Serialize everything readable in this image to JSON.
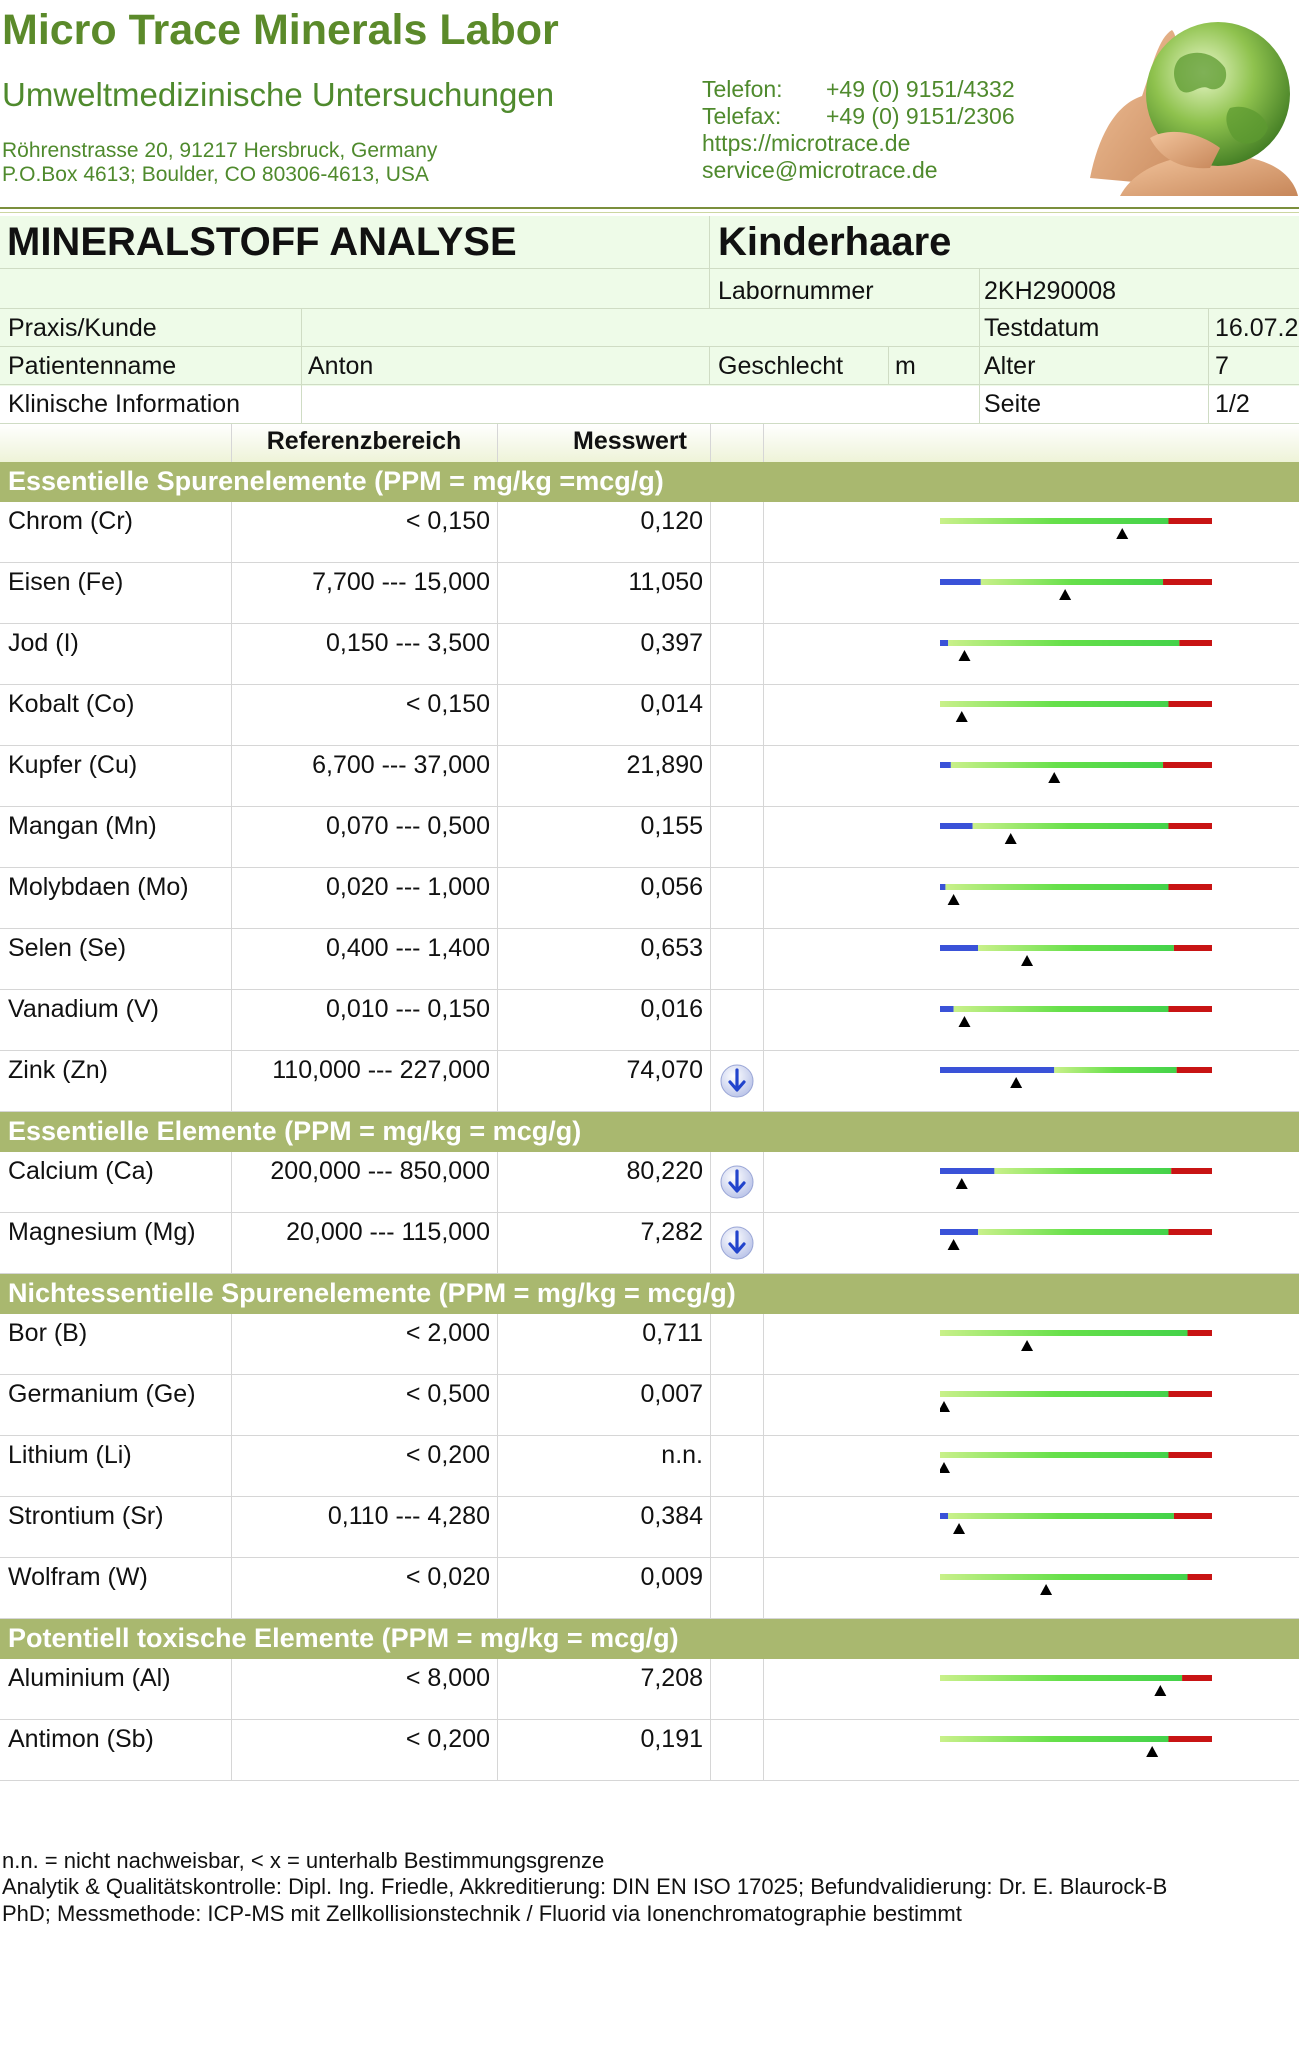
{
  "lab": {
    "name": "Micro Trace Minerals Labor",
    "subtitle": "Umweltmedizinische Untersuchungen",
    "address_lines": [
      "Röhrenstrasse 20, 91217 Hersbruck, Germany",
      "P.O.Box 4613; Boulder, CO 80306-4613, USA"
    ],
    "phone_label": "Telefon:",
    "phone": "+49 (0) 9151/4332",
    "fax_label": "Telefax:",
    "fax": "+49 (0) 9151/2306",
    "website": "https://microtrace.de",
    "email": "service@microtrace.de",
    "logo_icon": "hands-holding-globe"
  },
  "report": {
    "title": "MINERALSTOFF ANALYSE",
    "sample_type": "Kinderhaare",
    "lab_number_label": "Labornummer",
    "lab_number": "2KH290008",
    "client_label": "Praxis/Kunde",
    "client": "",
    "test_date_label": "Testdatum",
    "test_date": "16.07.2",
    "patient_label": "Patientenname",
    "patient": "Anton",
    "sex_label": "Geschlecht",
    "sex": "m",
    "age_label": "Alter",
    "age": "7",
    "clinical_label": "Klinische Information",
    "clinical": "",
    "page_label": "Seite",
    "page": "1/2"
  },
  "columns": {
    "reference": "Referenzbereich",
    "measured": "Messwert"
  },
  "sections": [
    {
      "title": "Essentielle Spurenelemente (PPM = mg/kg =mcg/g)",
      "rows": [
        {
          "name": "Chrom (Cr)",
          "ref": "< 0,150",
          "value": "0,120",
          "flag": "",
          "bar": {
            "low": 0,
            "high": 0.84,
            "marker": 0.67
          }
        },
        {
          "name": "Eisen (Fe)",
          "ref": "7,700 --- 15,000",
          "value": "11,050",
          "flag": "",
          "bar": {
            "low": 0.15,
            "high": 0.82,
            "marker": 0.46
          }
        },
        {
          "name": "Jod (I)",
          "ref": "0,150 --- 3,500",
          "value": "0,397",
          "flag": "",
          "bar": {
            "low": 0.03,
            "high": 0.88,
            "marker": 0.09
          }
        },
        {
          "name": "Kobalt (Co)",
          "ref": "< 0,150",
          "value": "0,014",
          "flag": "",
          "bar": {
            "low": 0,
            "high": 0.84,
            "marker": 0.08
          }
        },
        {
          "name": "Kupfer (Cu)",
          "ref": "6,700 --- 37,000",
          "value": "21,890",
          "flag": "",
          "bar": {
            "low": 0.04,
            "high": 0.82,
            "marker": 0.42
          }
        },
        {
          "name": "Mangan (Mn)",
          "ref": "0,070 --- 0,500",
          "value": "0,155",
          "flag": "",
          "bar": {
            "low": 0.12,
            "high": 0.84,
            "marker": 0.26
          }
        },
        {
          "name": "Molybdaen (Mo)",
          "ref": "0,020 --- 1,000",
          "value": "0,056",
          "flag": "",
          "bar": {
            "low": 0.02,
            "high": 0.84,
            "marker": 0.05
          }
        },
        {
          "name": "Selen (Se)",
          "ref": "0,400 --- 1,400",
          "value": "0,653",
          "flag": "",
          "bar": {
            "low": 0.14,
            "high": 0.86,
            "marker": 0.32
          }
        },
        {
          "name": "Vanadium (V)",
          "ref": "0,010 --- 0,150",
          "value": "0,016",
          "flag": "",
          "bar": {
            "low": 0.05,
            "high": 0.84,
            "marker": 0.09
          }
        },
        {
          "name": "Zink (Zn)",
          "ref": "110,000 --- 227,000",
          "value": "74,070",
          "flag": "down",
          "bar": {
            "low": 0.42,
            "high": 0.87,
            "marker": 0.28
          }
        }
      ]
    },
    {
      "title": "Essentielle Elemente (PPM = mg/kg = mcg/g)",
      "rows": [
        {
          "name": "Calcium (Ca)",
          "ref": "200,000 --- 850,000",
          "value": "80,220",
          "flag": "down",
          "bar": {
            "low": 0.2,
            "high": 0.85,
            "marker": 0.08
          }
        },
        {
          "name": "Magnesium (Mg)",
          "ref": "20,000 --- 115,000",
          "value": "7,282",
          "flag": "down",
          "bar": {
            "low": 0.14,
            "high": 0.84,
            "marker": 0.05
          }
        }
      ]
    },
    {
      "title": "Nichtessentielle Spurenelemente (PPM = mg/kg = mcg/g)",
      "rows": [
        {
          "name": "Bor (B)",
          "ref": "< 2,000",
          "value": "0,711",
          "flag": "",
          "bar": {
            "low": 0,
            "high": 0.91,
            "marker": 0.32
          }
        },
        {
          "name": "Germanium (Ge)",
          "ref": "< 0,500",
          "value": "0,007",
          "flag": "",
          "bar": {
            "low": 0,
            "high": 0.84,
            "marker": 0.01
          }
        },
        {
          "name": "Lithium (Li)",
          "ref": "< 0,200",
          "value": "n.n.",
          "flag": "",
          "bar": {
            "low": 0,
            "high": 0.84,
            "marker": 0.0
          }
        },
        {
          "name": "Strontium (Sr)",
          "ref": "0,110 --- 4,280",
          "value": "0,384",
          "flag": "",
          "bar": {
            "low": 0.03,
            "high": 0.86,
            "marker": 0.07
          }
        },
        {
          "name": "Wolfram (W)",
          "ref": "< 0,020",
          "value": "0,009",
          "flag": "",
          "bar": {
            "low": 0,
            "high": 0.91,
            "marker": 0.39
          }
        }
      ]
    },
    {
      "title": "Potentiell toxische Elemente (PPM = mg/kg = mcg/g)",
      "rows": [
        {
          "name": "Aluminium (Al)",
          "ref": "< 8,000",
          "value": "7,208",
          "flag": "",
          "bar": {
            "low": 0,
            "high": 0.89,
            "marker": 0.81
          }
        },
        {
          "name": "Antimon (Sb)",
          "ref": "< 0,200",
          "value": "0,191",
          "flag": "",
          "bar": {
            "low": 0,
            "high": 0.84,
            "marker": 0.78
          }
        }
      ]
    }
  ],
  "footer": [
    "n.n. = nicht nachweisbar, < x = unterhalb Bestimmungsgrenze",
    "Analytik & Qualitätskontrolle: Dipl. Ing. Friedle, Akkreditierung: DIN EN ISO 17025; Befundvalidierung: Dr. E. Blaurock-B",
    "PhD; Messmethode: ICP-MS mit Zellkollisionstechnik / Fluorid via Ionenchromatographie bestimmt"
  ],
  "colors": {
    "accent_green": "#5b8a2a",
    "section_band": "#a9b86f",
    "bar_low": "#3a52d8",
    "bar_normal": "#66e04a",
    "bar_high": "#c81414",
    "flag_arrow": "#2244cc"
  }
}
